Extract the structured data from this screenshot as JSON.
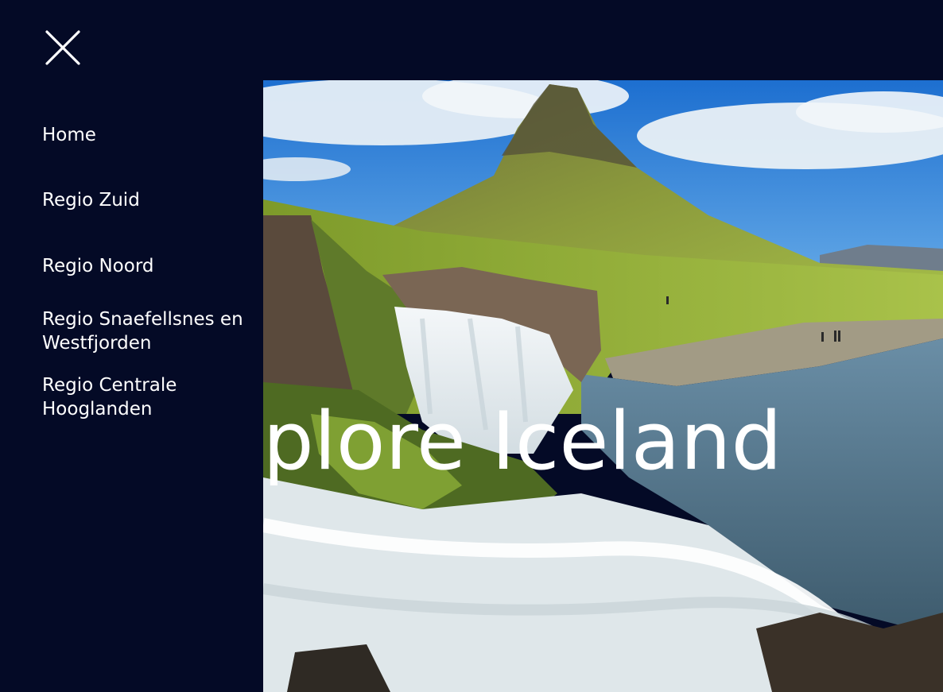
{
  "nav": {
    "close_icon": "close-icon",
    "items": [
      {
        "label": "Home"
      },
      {
        "label": "Regio Zuid"
      },
      {
        "label": "Regio Noord"
      },
      {
        "label": "Regio Snaefellsnes en Westfjorden"
      },
      {
        "label": "Regio Centrale Hooglanden"
      }
    ]
  },
  "hero": {
    "title": "Explore Iceland",
    "image_subject": "Kirkjufell mountain with Kirkjufellsfoss waterfall"
  },
  "colors": {
    "background": "#040a26",
    "text": "#ffffff"
  }
}
